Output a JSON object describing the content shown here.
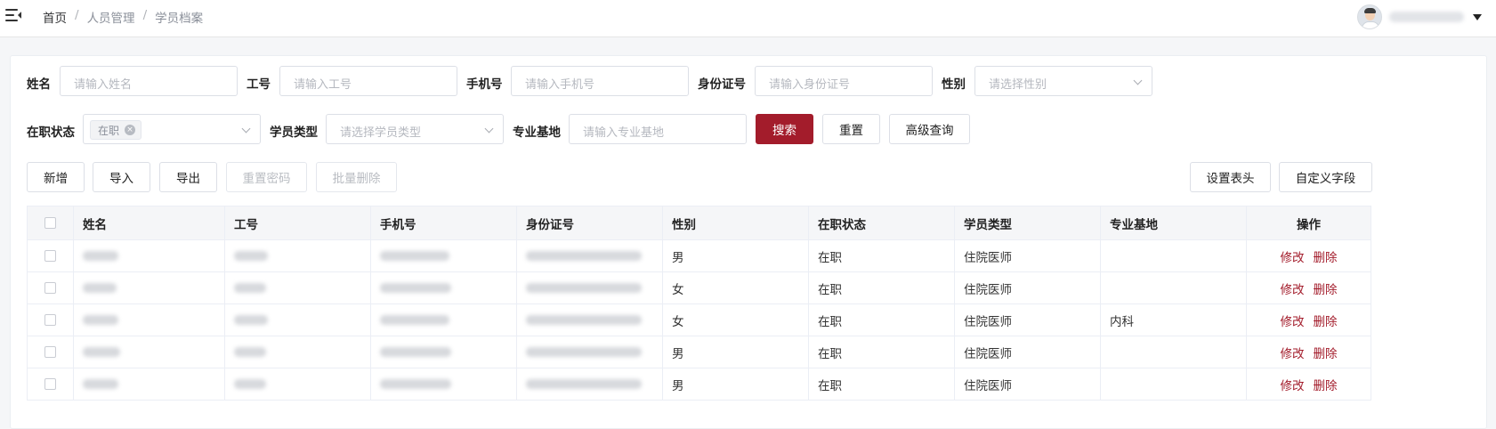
{
  "breadcrumb": [
    "首页",
    "人员管理",
    "学员档案"
  ],
  "breadcrumb_sep": "/",
  "filters": {
    "name": {
      "label": "姓名",
      "placeholder": "请输入姓名"
    },
    "job_no": {
      "label": "工号",
      "placeholder": "请输入工号"
    },
    "phone": {
      "label": "手机号",
      "placeholder": "请输入手机号"
    },
    "id_card": {
      "label": "身份证号",
      "placeholder": "请输入身份证号"
    },
    "gender": {
      "label": "性别",
      "placeholder": "请选择性别"
    },
    "status": {
      "label": "在职状态",
      "tag": "在职"
    },
    "student_type": {
      "label": "学员类型",
      "placeholder": "请选择学员类型"
    },
    "base": {
      "label": "专业基地",
      "placeholder": "请输入专业基地"
    }
  },
  "buttons": {
    "search": "搜索",
    "reset": "重置",
    "advanced": "高级查询",
    "add": "新增",
    "import": "导入",
    "export": "导出",
    "reset_password": "重置密码",
    "batch_delete": "批量删除",
    "set_header": "设置表头",
    "custom_field": "自定义字段"
  },
  "table": {
    "columns": [
      "姓名",
      "工号",
      "手机号",
      "身份证号",
      "性别",
      "在职状态",
      "学员类型",
      "专业基地",
      "操作"
    ],
    "rows": [
      {
        "gender": "男",
        "status": "在职",
        "type": "住院医师",
        "base": ""
      },
      {
        "gender": "女",
        "status": "在职",
        "type": "住院医师",
        "base": ""
      },
      {
        "gender": "女",
        "status": "在职",
        "type": "住院医师",
        "base": "内科"
      },
      {
        "gender": "男",
        "status": "在职",
        "type": "住院医师",
        "base": ""
      },
      {
        "gender": "男",
        "status": "在职",
        "type": "住院医师",
        "base": ""
      }
    ],
    "edit_label": "修改",
    "delete_label": "删除"
  },
  "colors": {
    "primary": "#a31c2b"
  }
}
